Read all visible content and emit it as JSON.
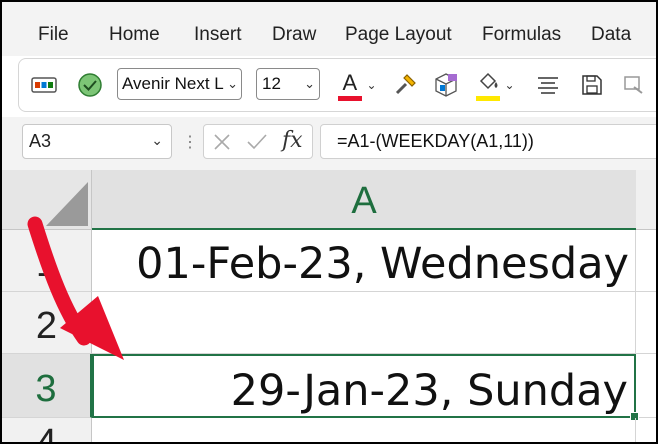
{
  "menu": {
    "items": [
      "File",
      "Home",
      "Insert",
      "Draw",
      "Page Layout",
      "Formulas",
      "Data"
    ]
  },
  "ribbon": {
    "font_name": "Avenir Next L",
    "font_size": "12",
    "font_color_letter": "A",
    "accent_red": "#e8112d",
    "accent_yellow": "#ffe800"
  },
  "formula_bar": {
    "name_box": "A3",
    "fx_label": "fx",
    "formula": "=A1-(WEEKDAY(A1,11))"
  },
  "sheet": {
    "column_header": "A",
    "rows": [
      {
        "row": "1",
        "value": "01-Feb-23, Wednesday"
      },
      {
        "row": "2",
        "value": ""
      },
      {
        "row": "3",
        "value": "29-Jan-23, Sunday"
      },
      {
        "row": "4",
        "value": ""
      }
    ]
  },
  "colors": {
    "selection_green": "#217346",
    "annotation_arrow": "#e8112d"
  }
}
